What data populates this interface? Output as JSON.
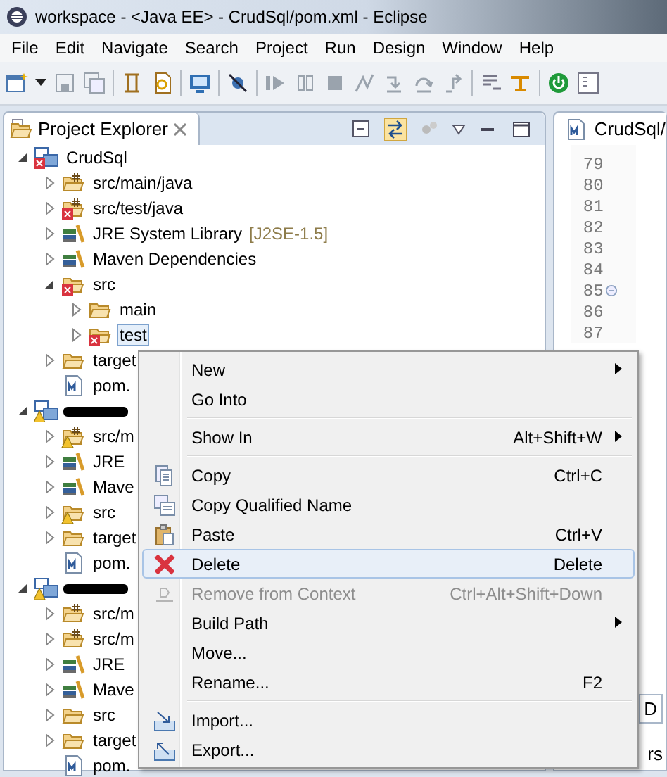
{
  "window": {
    "title": "workspace - <Java EE> - CrudSql/pom.xml - Eclipse"
  },
  "menu_bar": [
    "File",
    "Edit",
    "Navigate",
    "Search",
    "Project",
    "Run",
    "Design",
    "Window",
    "Help"
  ],
  "explorer": {
    "title": "Project Explorer",
    "tree": [
      {
        "kind": "project",
        "label": "CrudSql",
        "error": true,
        "warning": false,
        "expanded": true,
        "selected": false,
        "children": [
          {
            "kind": "source-folder",
            "label": "src/main/java",
            "error": false,
            "warning": false,
            "expanded": false,
            "selected": false
          },
          {
            "kind": "source-folder",
            "label": "src/test/java",
            "error": true,
            "warning": false,
            "expanded": false,
            "selected": false
          },
          {
            "kind": "library",
            "label": "JRE System Library",
            "suffix": "[J2SE-1.5]",
            "error": false,
            "warning": false,
            "expanded": false,
            "selected": false
          },
          {
            "kind": "library",
            "label": "Maven Dependencies",
            "error": false,
            "warning": false,
            "expanded": false,
            "selected": false
          },
          {
            "kind": "folder",
            "label": "src",
            "error": true,
            "warning": false,
            "expanded": true,
            "selected": false,
            "children": [
              {
                "kind": "folder",
                "label": "main",
                "error": false,
                "warning": false,
                "expanded": false,
                "selected": false
              },
              {
                "kind": "folder",
                "label": "test",
                "error": true,
                "warning": false,
                "expanded": false,
                "selected": true
              }
            ]
          },
          {
            "kind": "folder",
            "label": "target",
            "error": false,
            "warning": false,
            "expanded": false,
            "selected": false
          },
          {
            "kind": "pom",
            "label": "pom.",
            "error": false,
            "warning": false,
            "selected": false
          }
        ]
      },
      {
        "kind": "project",
        "redacted": true,
        "error": false,
        "warning": true,
        "expanded": true,
        "selected": false,
        "children": [
          {
            "kind": "source-folder",
            "label": "src/m",
            "error": false,
            "warning": true,
            "expanded": false,
            "selected": false
          },
          {
            "kind": "library",
            "label": "JRE",
            "error": false,
            "warning": false,
            "expanded": false,
            "selected": false
          },
          {
            "kind": "library",
            "label": "Mave",
            "error": false,
            "warning": false,
            "expanded": false,
            "selected": false
          },
          {
            "kind": "folder",
            "label": "src",
            "error": false,
            "warning": true,
            "expanded": false,
            "selected": false
          },
          {
            "kind": "folder",
            "label": "target",
            "error": false,
            "warning": false,
            "expanded": false,
            "selected": false
          },
          {
            "kind": "pom",
            "label": "pom.",
            "error": false,
            "warning": false,
            "selected": false
          }
        ]
      },
      {
        "kind": "project",
        "redacted": true,
        "error": false,
        "warning": true,
        "expanded": true,
        "selected": false,
        "children": [
          {
            "kind": "source-folder",
            "label": "src/m",
            "error": false,
            "warning": false,
            "expanded": false,
            "selected": false
          },
          {
            "kind": "source-folder",
            "label": "src/m",
            "error": false,
            "warning": false,
            "expanded": false,
            "selected": false
          },
          {
            "kind": "library",
            "label": "JRE",
            "error": false,
            "warning": false,
            "expanded": false,
            "selected": false
          },
          {
            "kind": "library",
            "label": "Mave",
            "error": false,
            "warning": false,
            "expanded": false,
            "selected": false
          },
          {
            "kind": "folder",
            "label": "src",
            "error": false,
            "warning": false,
            "expanded": false,
            "selected": false
          },
          {
            "kind": "folder",
            "label": "target",
            "error": false,
            "warning": false,
            "expanded": false,
            "selected": false
          },
          {
            "kind": "pom",
            "label": "pom.",
            "error": false,
            "warning": false,
            "selected": false
          }
        ]
      }
    ]
  },
  "editor": {
    "tab": "CrudSql/",
    "lines": [
      {
        "number": "79",
        "fold_marker": false
      },
      {
        "number": "80",
        "fold_marker": false
      },
      {
        "number": "81",
        "fold_marker": false
      },
      {
        "number": "82",
        "fold_marker": false
      },
      {
        "number": "83",
        "fold_marker": false
      },
      {
        "number": "84",
        "fold_marker": false
      },
      {
        "number": "85",
        "fold_marker": true
      },
      {
        "number": "86",
        "fold_marker": false
      },
      {
        "number": "87",
        "fold_marker": false
      }
    ]
  },
  "bottom_panel": {
    "tab": "D",
    "status": "rs"
  },
  "context_menu": [
    {
      "kind": "item",
      "label": "New",
      "submenu": true,
      "disabled": false,
      "selected": false
    },
    {
      "kind": "item",
      "label": "Go Into",
      "submenu": false,
      "disabled": false,
      "selected": false
    },
    {
      "kind": "separator"
    },
    {
      "kind": "item",
      "label": "Show In",
      "shortcut": "Alt+Shift+W",
      "submenu": true,
      "disabled": false,
      "selected": false
    },
    {
      "kind": "separator"
    },
    {
      "kind": "item",
      "label": "Copy",
      "shortcut": "Ctrl+C",
      "submenu": false,
      "disabled": false,
      "selected": false
    },
    {
      "kind": "item",
      "label": "Copy Qualified Name",
      "submenu": false,
      "disabled": false,
      "selected": false
    },
    {
      "kind": "item",
      "label": "Paste",
      "shortcut": "Ctrl+V",
      "submenu": false,
      "disabled": false,
      "selected": false
    },
    {
      "kind": "item",
      "label": "Delete",
      "shortcut": "Delete",
      "submenu": false,
      "disabled": false,
      "selected": true
    },
    {
      "kind": "item",
      "label": "Remove from Context",
      "shortcut": "Ctrl+Alt+Shift+Down",
      "submenu": false,
      "disabled": true,
      "selected": false
    },
    {
      "kind": "item",
      "label": "Build Path",
      "submenu": true,
      "disabled": false,
      "selected": false
    },
    {
      "kind": "item",
      "label": "Move...",
      "submenu": false,
      "disabled": false,
      "selected": false
    },
    {
      "kind": "item",
      "label": "Rename...",
      "shortcut": "F2",
      "submenu": false,
      "disabled": false,
      "selected": false
    },
    {
      "kind": "separator"
    },
    {
      "kind": "item",
      "label": "Import...",
      "submenu": false,
      "disabled": false,
      "selected": false
    },
    {
      "kind": "item",
      "label": "Export...",
      "submenu": false,
      "disabled": false,
      "selected": false
    }
  ]
}
